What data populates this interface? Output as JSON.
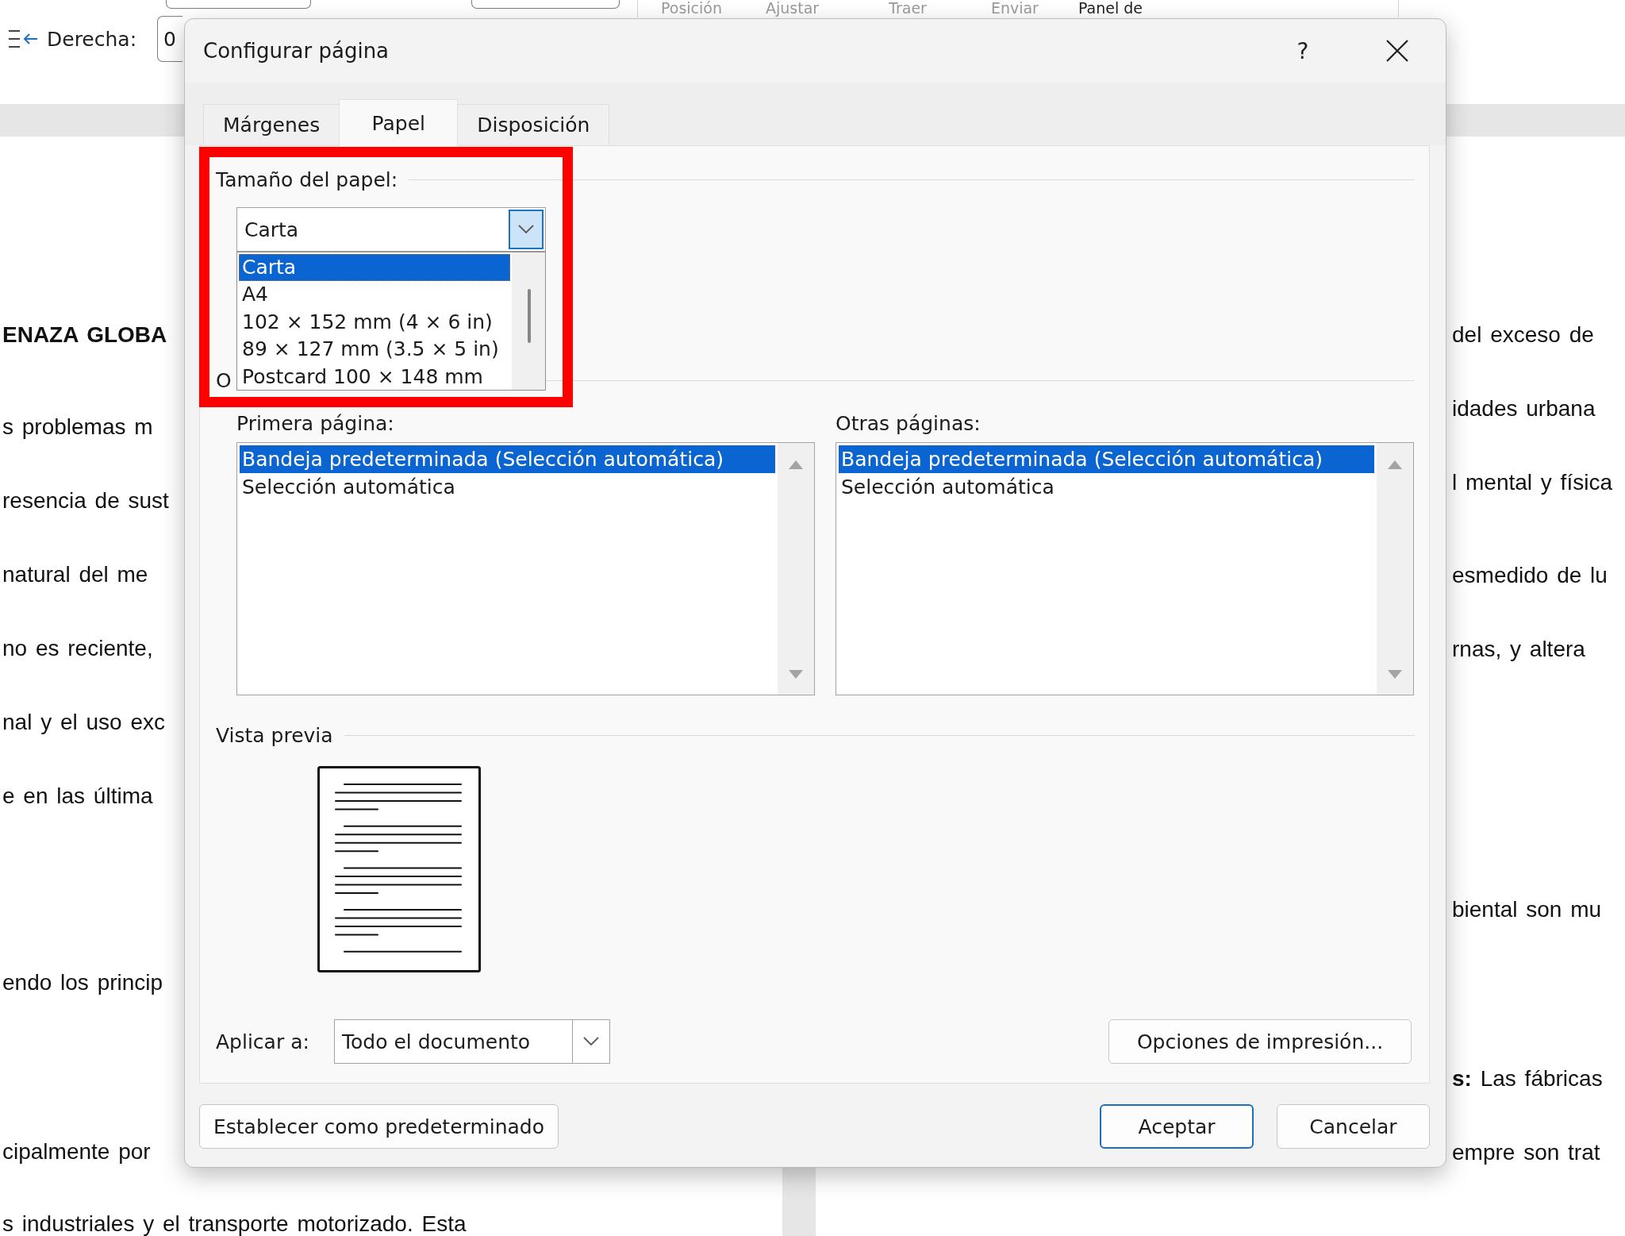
{
  "ribbon": {
    "arrange_labels": [
      {
        "label": "Posición",
        "disabled": true
      },
      {
        "label": "Ajustar",
        "disabled": true
      },
      {
        "label": "Traer",
        "disabled": true
      },
      {
        "label": "Enviar",
        "disabled": true
      },
      {
        "label": "Panel de",
        "disabled": false
      }
    ],
    "indent_right": {
      "label": "Derecha:",
      "value": "0"
    }
  },
  "document": {
    "left_page_lines": [
      {
        "text": "ENAZA GLOBA",
        "kind": "heading"
      },
      {
        "text": "s problemas m",
        "kind": "body"
      },
      {
        "text": "resencia de sust",
        "kind": "body"
      },
      {
        "text": "natural del me",
        "kind": "body"
      },
      {
        "text": "no es reciente,",
        "kind": "body"
      },
      {
        "text": "nal y el uso exc",
        "kind": "body"
      },
      {
        "text": "e en las última",
        "kind": "body"
      },
      {
        "text": "endo los princip",
        "kind": "body"
      },
      {
        "text": "cipalmente por",
        "kind": "body"
      },
      {
        "text": "s industriales y el transporte motorizado. Esta",
        "kind": "body"
      }
    ],
    "right_page_lines": [
      {
        "text": "del exceso de",
        "kind": "body"
      },
      {
        "text": "idades urbana",
        "kind": "body"
      },
      {
        "text": "l mental y física",
        "kind": "body"
      },
      {
        "text": "esmedido de lu",
        "kind": "body"
      },
      {
        "text": "rnas, y altera",
        "kind": "body"
      },
      {
        "text": "biental son mu",
        "kind": "body"
      },
      {
        "text": "**s:** Las fábricas",
        "kind": "body"
      },
      {
        "text": "empre son trat",
        "kind": "body"
      }
    ]
  },
  "dialog": {
    "title": "Configurar página",
    "help_button": "?",
    "tabs": [
      {
        "label": "Márgenes",
        "selected": false
      },
      {
        "label": "Papel",
        "selected": true
      },
      {
        "label": "Disposición",
        "selected": false
      }
    ],
    "paper_size": {
      "label": "Tamaño del papel:",
      "value": "Carta",
      "expanded": true,
      "highlighted": true,
      "options": [
        {
          "label": "Carta",
          "selected": true
        },
        {
          "label": "A4",
          "selected": false
        },
        {
          "label": "102 × 152 mm (4 × 6 in)",
          "selected": false
        },
        {
          "label": "89 × 127 mm (3.5 × 5 in)",
          "selected": false
        },
        {
          "label": "Postcard 100 × 148 mm",
          "selected": false
        }
      ]
    },
    "paper_source": {
      "label": "O",
      "first_page": {
        "label": "Primera página:",
        "items": [
          {
            "label": "Bandeja predeterminada (Selección automática)",
            "selected": true
          },
          {
            "label": "Selección automática",
            "selected": false
          }
        ]
      },
      "other_pages": {
        "label": "Otras páginas:",
        "items": [
          {
            "label": "Bandeja predeterminada (Selección automática)",
            "selected": true
          },
          {
            "label": "Selección automática",
            "selected": false
          }
        ]
      }
    },
    "preview": {
      "label": "Vista previa"
    },
    "apply_to": {
      "label": "Aplicar a:",
      "value": "Todo el documento"
    },
    "print_options_button": "Opciones de impresión...",
    "buttons": [
      {
        "label": "Establecer como predeterminado",
        "kind": "secondary"
      },
      {
        "label": "Aceptar",
        "kind": "default"
      },
      {
        "label": "Cancelar",
        "kind": "secondary"
      }
    ]
  }
}
